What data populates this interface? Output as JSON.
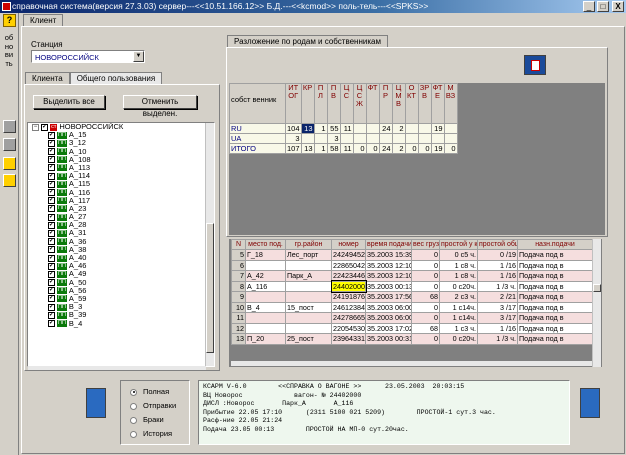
{
  "window": {
    "title": "справочная система(версия 27.3.03) сервер---<<10.51.166.12>> Б.Д.---<<kcmod>> поль-тель---<<SPKS>>",
    "btn_min": "_",
    "btn_max": "□",
    "btn_close": "X"
  },
  "leftbar": {
    "help": "?",
    "refresh": "обновить"
  },
  "main_tabs": [
    "Клиент"
  ],
  "station": {
    "label": "Станция",
    "value": "НОВОРОССИЙСК"
  },
  "left_tabs": [
    "Клиента",
    "Общего пользования"
  ],
  "buttons": {
    "select_all": "Выделить все",
    "deselect": "Отменить выделен."
  },
  "tree": {
    "root": "НОВОРОССИЙСК",
    "items": [
      "А_15",
      "З_12",
      "А_10",
      "А_108",
      "А_113",
      "А_114",
      "А_115",
      "А_116",
      "А_117",
      "А_23",
      "А_27",
      "А_28",
      "А_31",
      "А_36",
      "А_38",
      "А_40",
      "А_46",
      "А_49",
      "А_50",
      "А_56",
      "А_59",
      "В_3",
      "В_39",
      "В_4"
    ]
  },
  "breakdown": {
    "tab": "Разложение по родам и собственникам",
    "headers": [
      "собст венник",
      "ИТОГ",
      "КР",
      "ПЛ",
      "ПВ",
      "ЦС",
      "ЦСЖ",
      "ФТ",
      "ПР",
      "ЦМВ",
      "ОКТ",
      "ЗРВ",
      "ФТЕ",
      "МВЗ"
    ],
    "rows": [
      [
        "RU",
        "104",
        "13",
        "1",
        "55",
        "11",
        "",
        "",
        "24",
        "2",
        "",
        "",
        "19",
        ""
      ],
      [
        "UA",
        "3",
        "",
        "",
        "3",
        "",
        "",
        "",
        "",
        "",
        "",
        "",
        "",
        ""
      ],
      [
        "ИТОГО",
        "107",
        "13",
        "1",
        "58",
        "11",
        "0",
        "0",
        "24",
        "2",
        "0",
        "0",
        "19",
        "0"
      ]
    ]
  },
  "wagons": {
    "headers": [
      "N",
      "место под.",
      "гр.район",
      "номер",
      "время подачи",
      "вес груза",
      "простой у кл.",
      "простой общ.",
      "назн.подачи"
    ],
    "rows": [
      [
        "5",
        "Г_18",
        "Лес_порт",
        "24249452",
        "35.2003 15:39",
        "0",
        "0 с5 ч.",
        "0 /19",
        "Подача под в"
      ],
      [
        "6",
        "",
        "",
        "22865042",
        "35.2003 12:10",
        "0",
        "1 с8 ч.",
        "1 /16",
        "Подача под в"
      ],
      [
        "7",
        "А_42",
        "Парк_А",
        "22423446",
        "35.2003 12:10",
        "0",
        "1 с8 ч.",
        "1 /16",
        "Подача под в"
      ],
      [
        "8",
        "А_116",
        "",
        "24402000",
        "35.2003 00:13",
        "0",
        "0 с20ч.",
        "1 /3 ч.",
        "Подача под в"
      ],
      [
        "9",
        "",
        "",
        "24191876",
        "35.2003 17:56",
        "68",
        "2 с3 ч.",
        "2 /21",
        "Подача под в"
      ],
      [
        "10",
        "В_4",
        "15_пост",
        "24612384",
        "35.2003 06:00",
        "0",
        "1 с14ч.",
        "3 /17",
        "Подача под в"
      ],
      [
        "11",
        "",
        "",
        "24278665",
        "35.2003 06:00",
        "0",
        "1 с14ч.",
        "3 /17",
        "Подача под в"
      ],
      [
        "12",
        "",
        "",
        "22054530",
        "35.2003 17:02",
        "68",
        "1 с3 ч.",
        "1 /16",
        "Подача под в"
      ],
      [
        "13",
        "П_20",
        "25_пост",
        "23964331",
        "35.2003 00:31",
        "0",
        "0 с20ч.",
        "1 /3 ч.",
        "Подача под в"
      ]
    ]
  },
  "radios": {
    "options": [
      "Полная",
      "Отправки",
      "Браки",
      "История"
    ],
    "selected": 0
  },
  "info": {
    "lines": [
      "КСАРМ V-6.0        <<СПРАВКА О ВАГОНЕ >>      23.05.2003  20:03:15",
      "ВЦ Новорос             вагон- № 24402000",
      "ДИСЛ :Новорос       Парк_А       А_116",
      "Прибытие 22.05 17:10      (2311 5100 021 5209)        ПРОСТОЙ-1 сут.3 час.",
      "Расф-ние 22.05 21:24",
      "Подача 23.05 00:13        ПРОСТОЙ НА МП-0 сут.20час."
    ]
  },
  "colors": {
    "highlight_cell": "#0a246a",
    "selected_number_bg": "#ffff00",
    "row_odd": "#f5dede",
    "row_bg": "#ffffff",
    "info_bg": "#eef7ee"
  }
}
